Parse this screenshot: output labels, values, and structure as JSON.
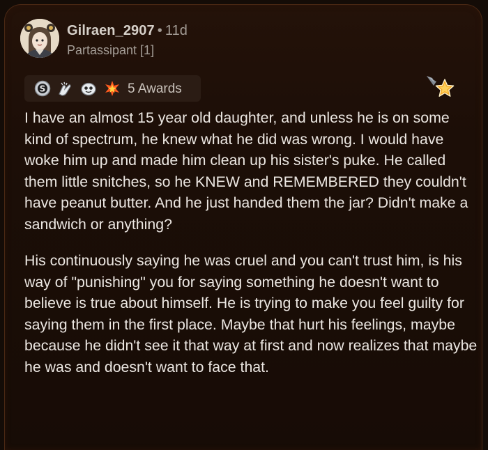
{
  "post": {
    "username": "Gilraen_2907",
    "separator": "•",
    "age": "11d",
    "flair": "Partassipant [1]"
  },
  "awards": {
    "icons": [
      "silver-award-icon",
      "hands-award-icon",
      "face-award-icon",
      "burst-award-icon"
    ],
    "count_label": "5 Awards"
  },
  "badge": {
    "icon": "gold-star-badge-icon",
    "color": "#f5a623"
  },
  "comment": {
    "paragraphs": [
      "I have an almost 15 year old daughter, and unless he is on some kind of spectrum, he knew what he did was wrong. I would have woke him up and made him clean up his sister's puke. He called them little snitches, so he KNEW and REMEMBERED they couldn't have peanut butter. And he just handed them the jar? Didn't make a sandwich or anything?",
      "His continuously saying he was cruel and you can't trust him, is his way of \"punishing\" you for saying something he doesn't want to believe is true about himself. He is trying to make you feel guilty for saying them in the first place. Maybe that hurt his feelings, maybe because he didn't see it that way at first and now realizes that maybe he was and doesn't want to face that."
    ]
  },
  "colors": {
    "background": "#140c07",
    "card_border": "#4a2814",
    "text": "#ece7e2",
    "muted_text": "#a49d96"
  }
}
